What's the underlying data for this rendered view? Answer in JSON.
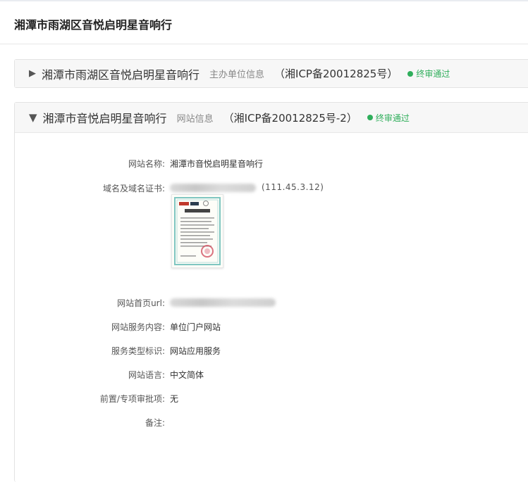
{
  "page": {
    "title": "湘潭市雨湖区音悦启明星音响行"
  },
  "panels": [
    {
      "caret": "▶",
      "name": "湘潭市雨湖区音悦启明星音响行",
      "type": "主办单位信息",
      "icp": "（湘ICP备20012825号）",
      "status": "终审通过"
    },
    {
      "caret": "▼",
      "name": "湘潭市音悦启明星音响行",
      "type": "网站信息",
      "icp": "（湘ICP备20012825号-2）",
      "status": "终审通过"
    }
  ],
  "site_info": {
    "site_name_label": "网站名称:",
    "site_name": "湘潭市音悦启明星音响行",
    "domain_label": "域名及域名证书:",
    "domain_ip": "(111.45.3.12)",
    "homepage_label": "网站首页url:",
    "service_content_label": "网站服务内容:",
    "service_content": "单位门户网站",
    "service_type_label": "服务类型标识:",
    "service_type": "网站应用服务",
    "language_label": "网站语言:",
    "language": "中文简体",
    "approval_label": "前置/专项审批项:",
    "approval": "无",
    "remark_label": "备注:",
    "remark": ""
  },
  "colors": {
    "status_green": "#2fae5b",
    "header_bg": "#f7f7f7",
    "border": "#e3e3e3"
  },
  "icons": {
    "collapsed": "caret-right-icon",
    "expanded": "caret-down-icon",
    "status": "status-dot-icon"
  }
}
